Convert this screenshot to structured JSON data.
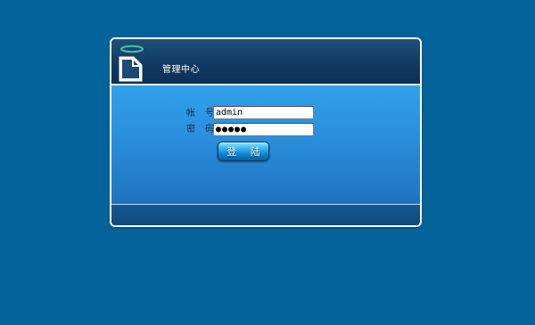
{
  "panel": {
    "title": "管理中心"
  },
  "form": {
    "username_label": "帐 号",
    "password_label": "密 码",
    "colon": ":",
    "username_value": "admin",
    "password_value": "●●●●●",
    "login_button_label": "登 陆"
  },
  "icons": {
    "logo": "document-with-halo-icon"
  },
  "colors": {
    "background": "#04639a",
    "header": "#123a61",
    "body": "#2a8edb",
    "footer": "#0f4a7c",
    "button": "#1a92d6"
  }
}
